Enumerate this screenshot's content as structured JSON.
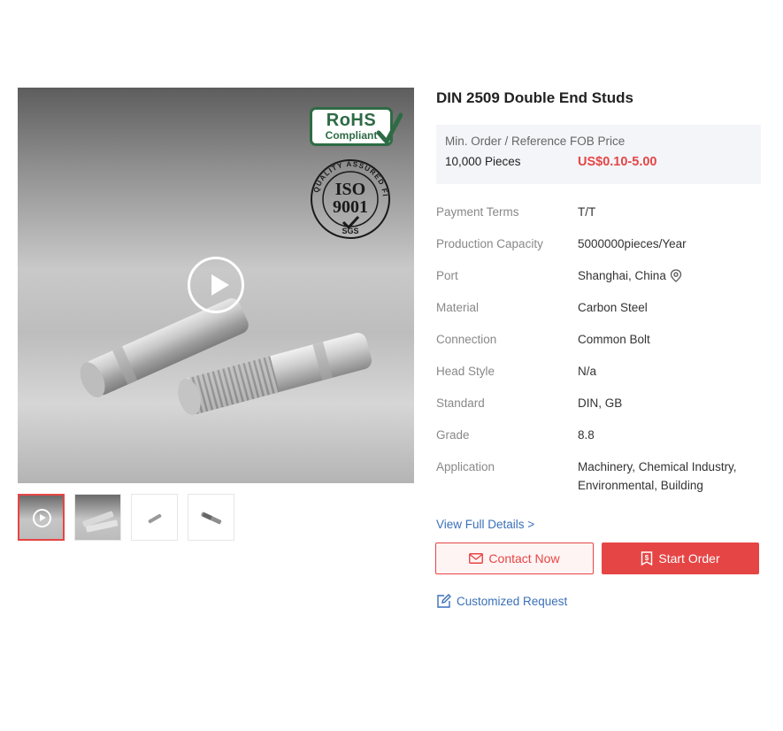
{
  "product": {
    "title": "DIN 2509 Double End Studs"
  },
  "price_box": {
    "header": "Min. Order / Reference FOB Price",
    "quantity": "10,000 Pieces",
    "price": "US$0.10-5.00"
  },
  "attributes": [
    {
      "label": "Payment Terms",
      "value": "T/T"
    },
    {
      "label": "Production Capacity",
      "value": "5000000pieces/Year"
    },
    {
      "label": "Port",
      "value": "Shanghai, China"
    },
    {
      "label": "Material",
      "value": "Carbon Steel"
    },
    {
      "label": "Connection",
      "value": "Common Bolt"
    },
    {
      "label": "Head Style",
      "value": "N/a"
    },
    {
      "label": "Standard",
      "value": "DIN, GB"
    },
    {
      "label": "Grade",
      "value": "8.8"
    },
    {
      "label": "Application",
      "value": "Machinery, Chemical Industry, Environmental, Building"
    }
  ],
  "badges": {
    "rohs_line1": "RoHS",
    "rohs_line2": "Compliant",
    "iso_line1": "ISO",
    "iso_line2": "9001",
    "iso_ring": "QUALITY ASSURED FIRM",
    "sgs": "SGS"
  },
  "actions": {
    "view_details": "View Full Details >",
    "contact_now": "Contact Now",
    "start_order": "Start Order",
    "customized_request": "Customized Request"
  },
  "icons": {
    "play": "play-icon",
    "pin": "location-pin-icon",
    "mail": "mail-icon",
    "order": "order-icon",
    "edit": "edit-icon"
  },
  "colors": {
    "accent_red": "#e64545",
    "link_blue": "#3a6fb8",
    "rohs_green": "#2e6b45",
    "price_box_bg": "#f3f5f9"
  }
}
